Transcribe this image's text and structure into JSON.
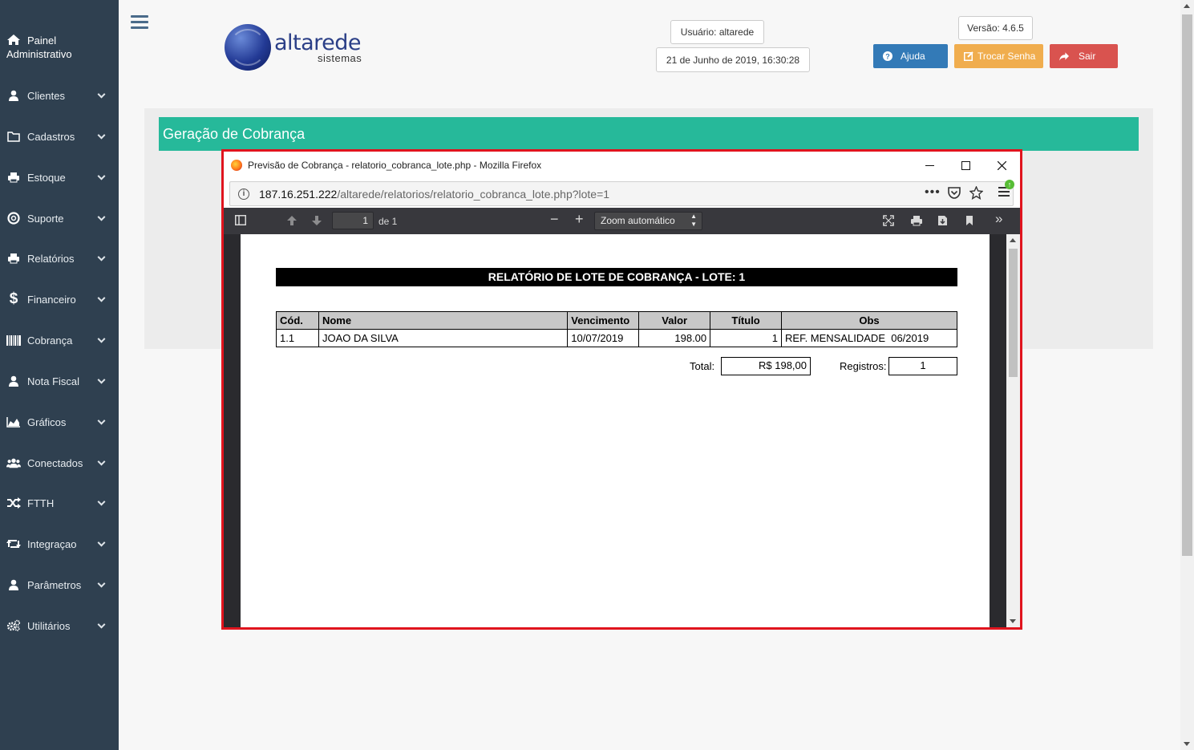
{
  "sidebar": {
    "header_line1": "Painel",
    "header_line2": "Administrativo",
    "items": [
      {
        "label": "Clientes",
        "icon": "user-icon"
      },
      {
        "label": "Cadastros",
        "icon": "folder-icon"
      },
      {
        "label": "Estoque",
        "icon": "print-icon"
      },
      {
        "label": "Suporte",
        "icon": "lifebuoy-icon"
      },
      {
        "label": "Relatórios",
        "icon": "print-icon"
      },
      {
        "label": "Financeiro",
        "icon": "dollar-icon"
      },
      {
        "label": "Cobrança",
        "icon": "barcode-icon"
      },
      {
        "label": "Nota Fiscal",
        "icon": "user-icon"
      },
      {
        "label": "Gráficos",
        "icon": "area-chart-icon"
      },
      {
        "label": "Conectados",
        "icon": "users-icon"
      },
      {
        "label": "FTTH",
        "icon": "random-icon"
      },
      {
        "label": "Integraçao",
        "icon": "retweet-icon"
      },
      {
        "label": "Parâmetros",
        "icon": "user-icon"
      },
      {
        "label": "Utilitários",
        "icon": "cogs-icon"
      }
    ]
  },
  "header": {
    "logo_word": "altarede",
    "logo_sub": "sistemas",
    "user": "Usuário: altarede",
    "datetime": "21 de Junho de 2019, 16:30:28",
    "version": "Versão: 4.6.5",
    "help_label": "Ajuda",
    "change_password_label": "Trocar Senha",
    "logout_label": "Sair",
    "colors": {
      "help": "#337ab7",
      "change_password": "#f0ad4e",
      "logout": "#d9534f"
    }
  },
  "main": {
    "panel_title": "Geração de Cobrança",
    "panel_color": "#26b99a"
  },
  "firefox": {
    "window_title": "Previsão de Cobrança - relatorio_cobranca_lote.php - Mozilla Firefox",
    "url_host": "187.16.251.222",
    "url_path": "/altarede/relatorios/relatorio_cobranca_lote.php?lote=1",
    "pdf": {
      "page_number": "1",
      "page_of": "de 1",
      "zoom": "Zoom automático"
    }
  },
  "report": {
    "title": "RELATÓRIO DE LOTE DE COBRANÇA - LOTE: 1",
    "columns": [
      "Cód.",
      "Nome",
      "Vencimento",
      "Valor",
      "Título",
      "Obs"
    ],
    "rows": [
      {
        "cod": "1.1",
        "nome": "JOAO DA SILVA",
        "vencimento": "10/07/2019",
        "valor": "198.00",
        "titulo": "1",
        "obs": "REF. MENSALIDADE  06/2019"
      }
    ],
    "total_label": "Total:",
    "total_value": "R$ 198,00",
    "registros_label": "Registros:",
    "registros_value": "1"
  }
}
